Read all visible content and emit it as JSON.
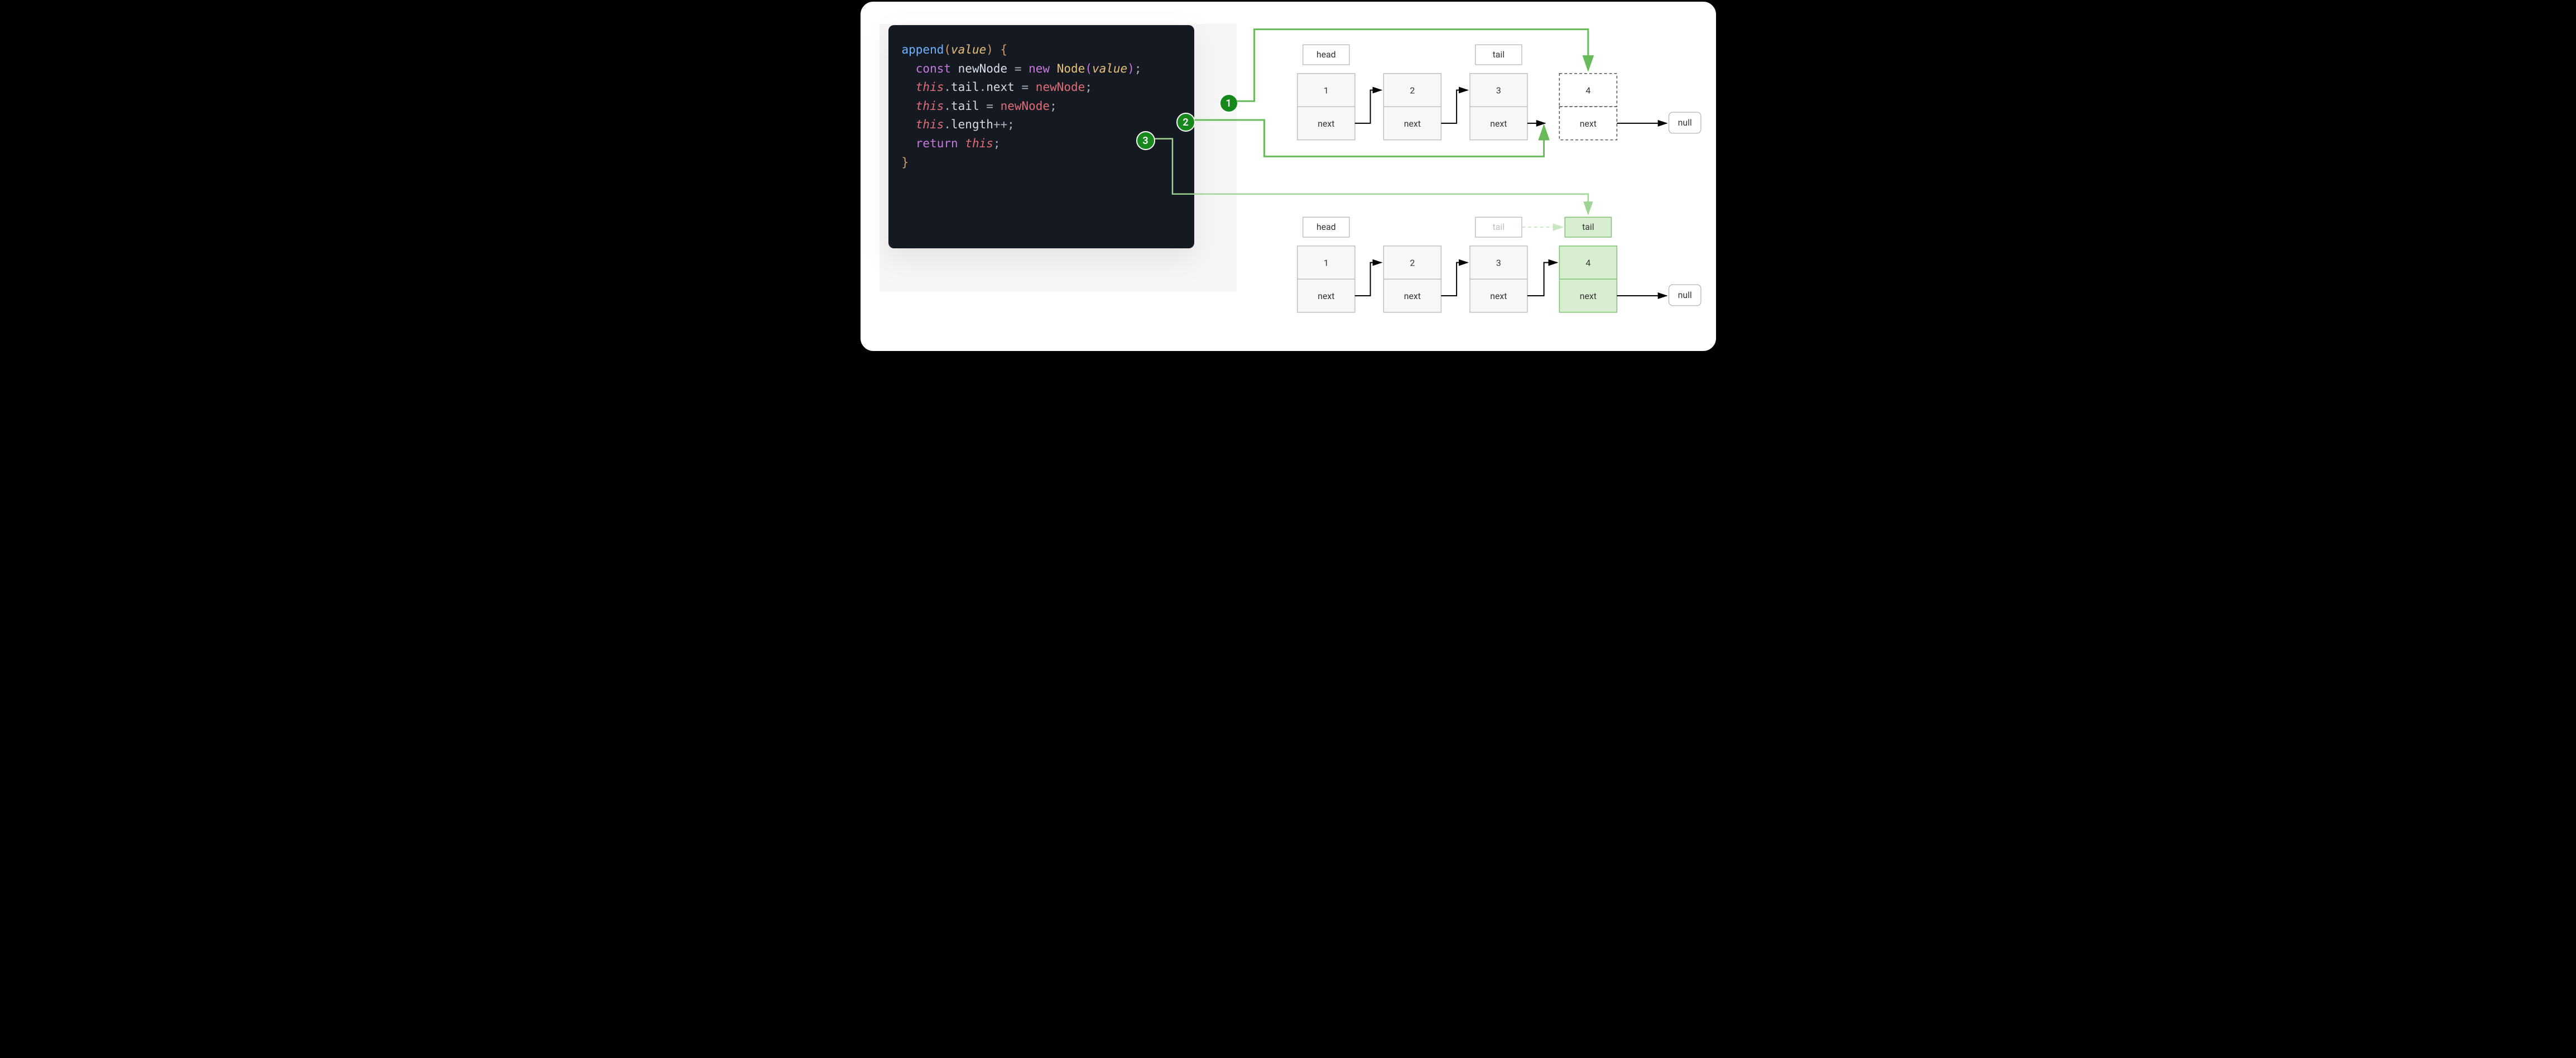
{
  "code": {
    "fn": "append",
    "param": "value",
    "kw_const": "const",
    "var_newNode": "newNode",
    "kw_new": "new",
    "cls_Node": "Node",
    "kw_this": "this",
    "prop_tail": "tail",
    "prop_next": "next",
    "prop_length": "length",
    "kw_return": "return",
    "op_eq": "=",
    "op_inc": "++",
    "open_brace": "{",
    "close_brace": "}",
    "open_paren": "(",
    "close_paren": ")",
    "semi": ";",
    "dot": "."
  },
  "steps": {
    "s1": "1",
    "s2": "2",
    "s3": "3"
  },
  "labels": {
    "head": "head",
    "tail": "tail",
    "next": "next",
    "null": "null"
  },
  "diagram": {
    "before": {
      "nodes": [
        "1",
        "2",
        "3",
        "4"
      ]
    },
    "after": {
      "nodes": [
        "1",
        "2",
        "3",
        "4"
      ]
    },
    "new_node_is_dashed_in_before": true,
    "new_node_is_green_in_after": true
  },
  "colors": {
    "step_green": "#17881c",
    "arrow_green": "#68ba5a",
    "arrow_green_light": "#9fd493",
    "node_green_fill": "#d7efd0",
    "node_green_stroke": "#86c27a",
    "code_bg": "#151a22"
  }
}
